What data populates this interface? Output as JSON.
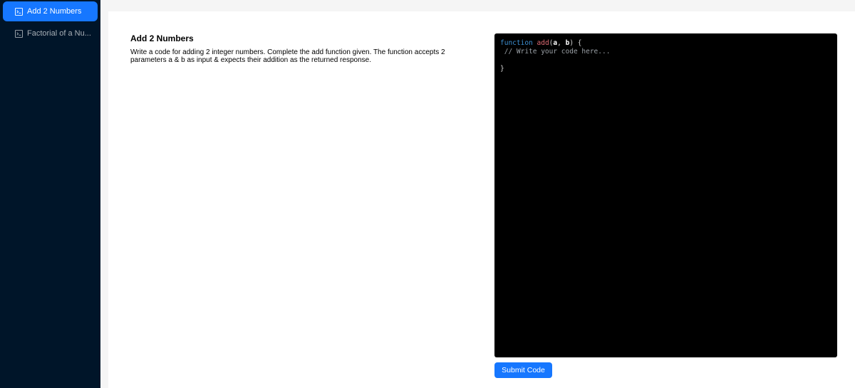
{
  "sidebar": {
    "items": [
      {
        "label": "Add 2 Numbers",
        "icon": "code-icon",
        "active": true
      },
      {
        "label": "Factorial of a Nu...",
        "icon": "code-icon",
        "active": false
      }
    ]
  },
  "question": {
    "title": "Add 2 Numbers",
    "description": "Write a code for adding 2 integer numbers. Complete the add function given. The function accepts 2 parameters a & b as input & expects their addition as the returned response."
  },
  "editor": {
    "keyword": "function",
    "function_name": "add",
    "paren_open": "(",
    "param_a": "a",
    "comma": ", ",
    "param_b": "b",
    "signature_end": ") {",
    "comment": " // Write your code here...",
    "closing_brace": "}"
  },
  "actions": {
    "submit_label": "Submit Code"
  },
  "colors": {
    "sidebar_bg": "#001529",
    "accent": "#1677ff",
    "editor_bg": "#000000"
  }
}
